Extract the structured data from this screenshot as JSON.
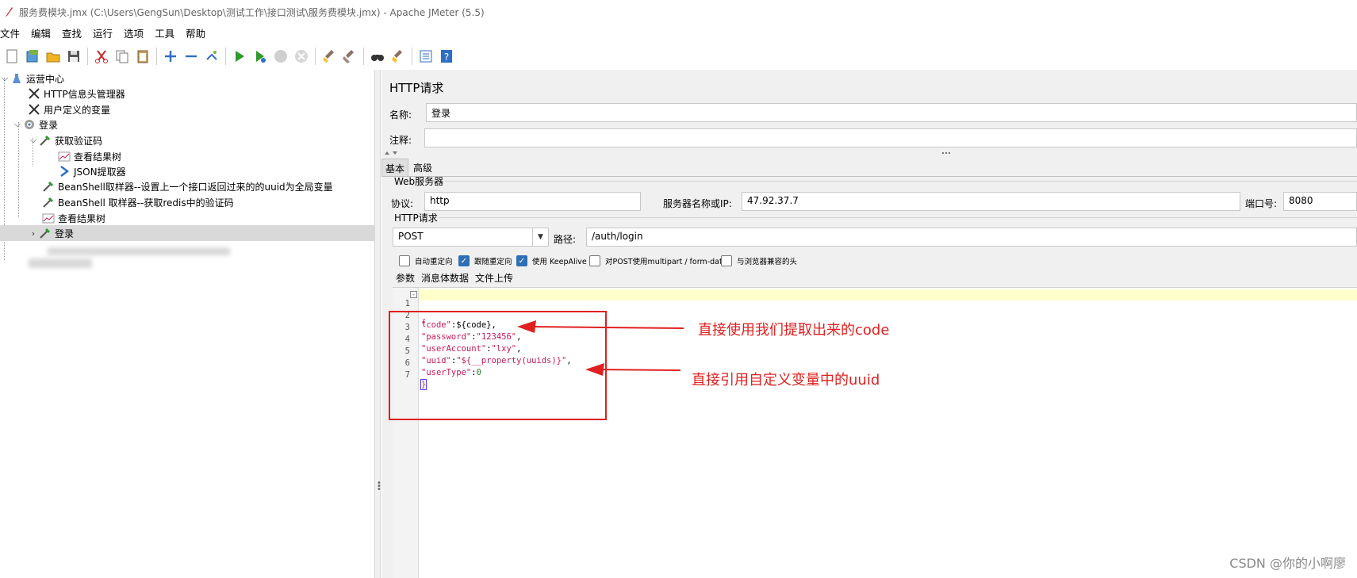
{
  "window": {
    "title": "服务费模块.jmx (C:\\Users\\GengSun\\Desktop\\测试工作\\接口测试\\服务费模块.jmx) - Apache JMeter (5.5)"
  },
  "menu": [
    "文件",
    "编辑",
    "查找",
    "运行",
    "选项",
    "工具",
    "帮助"
  ],
  "toolbar_icons": [
    "new-icon",
    "templates-icon",
    "open-icon",
    "save-icon",
    "cut-icon",
    "copy-icon",
    "paste-icon",
    "expand-icon",
    "collapse-icon",
    "toggle-icon",
    "start-icon",
    "start-no-pauses-icon",
    "stop-icon",
    "shutdown-icon",
    "clear-icon",
    "clear-all-icon",
    "search-icon",
    "reset-search-icon",
    "function-helper-icon",
    "help-icon"
  ],
  "tree": {
    "items": [
      {
        "label": "运营中心",
        "icon": "test-plan-icon"
      },
      {
        "label": "HTTP信息头管理器",
        "icon": "config-wrench-icon"
      },
      {
        "label": "用户定义的变量",
        "icon": "config-wrench-icon"
      },
      {
        "label": "登录",
        "icon": "thread-group-gear-icon"
      },
      {
        "label": "获取验证码",
        "icon": "sampler-pipette-icon"
      },
      {
        "label": "查看结果树",
        "icon": "listener-chart-icon"
      },
      {
        "label": "JSON提取器",
        "icon": "extractor-arrow-icon"
      },
      {
        "label": "BeanShell取样器--设置上一个接口返回过来的的uuid为全局变量",
        "icon": "sampler-pipette-icon"
      },
      {
        "label": "BeanShell 取样器--获取redis中的验证码",
        "icon": "sampler-pipette-icon"
      },
      {
        "label": "查看结果树",
        "icon": "listener-chart-icon"
      },
      {
        "label": "登录",
        "icon": "sampler-pipette-icon"
      }
    ]
  },
  "panel": {
    "title": "HTTP请求",
    "name_label": "名称:",
    "name_value": "登录",
    "comment_label": "注释:",
    "comment_value": "",
    "tabs": [
      "基本",
      "高级"
    ],
    "web_server": {
      "group_title": "Web服务器",
      "protocol_label": "协议:",
      "protocol_value": "http",
      "server_label": "服务器名称或IP:",
      "server_value": "47.92.37.7",
      "port_label": "端口号:",
      "port_value": "8080"
    },
    "http_request": {
      "group_title": "HTTP请求",
      "method": "POST",
      "path_label": "路径:",
      "path_value": "/auth/login"
    },
    "checkboxes": [
      {
        "label": "自动重定向",
        "checked": false
      },
      {
        "label": "跟随重定向",
        "checked": true
      },
      {
        "label": "使用 KeepAlive",
        "checked": true
      },
      {
        "label": "对POST使用multipart / form-data",
        "checked": false
      },
      {
        "label": "与浏览器兼容的头",
        "checked": false
      }
    ],
    "body_tabs": [
      "参数",
      "消息体数据",
      "文件上传"
    ]
  },
  "editor": {
    "lines": [
      {
        "n": "1",
        "text": "{"
      },
      {
        "n": "2",
        "text": "\"code\":${code},"
      },
      {
        "n": "3",
        "text": "\"password\":\"123456\","
      },
      {
        "n": "4",
        "text": "\"userAccount\":\"lxy\","
      },
      {
        "n": "5",
        "text": "\"uuid\":\"${__property(uuids)}\","
      },
      {
        "n": "6",
        "text": "\"userType\":0"
      },
      {
        "n": "7",
        "text": "}"
      }
    ]
  },
  "annotations": {
    "code_note": "直接使用我们提取出来的code",
    "uuid_note": "直接引用自定义变量中的uuid"
  },
  "watermark": "CSDN @你的小啊廖",
  "colors": {
    "annotation_red": "#e02020",
    "json_key": "#c2185b",
    "checkbox_checked": "#2f6fb6",
    "selected_row": "#d9d9d9"
  }
}
